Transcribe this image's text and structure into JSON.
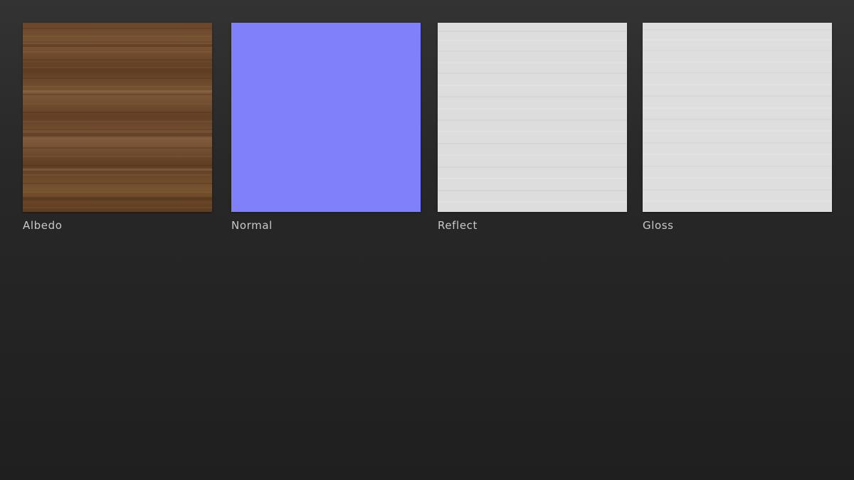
{
  "textures": [
    {
      "label": "Albedo",
      "kind": "wood-albedo",
      "base_color": "#6e4a2e"
    },
    {
      "label": "Normal",
      "kind": "flat-normal",
      "base_color": "#8080ff"
    },
    {
      "label": "Reflect",
      "kind": "grain-gray",
      "base_color": "#dcdcdc"
    },
    {
      "label": "Gloss",
      "kind": "grain-gray",
      "base_color": "#dedede"
    }
  ]
}
